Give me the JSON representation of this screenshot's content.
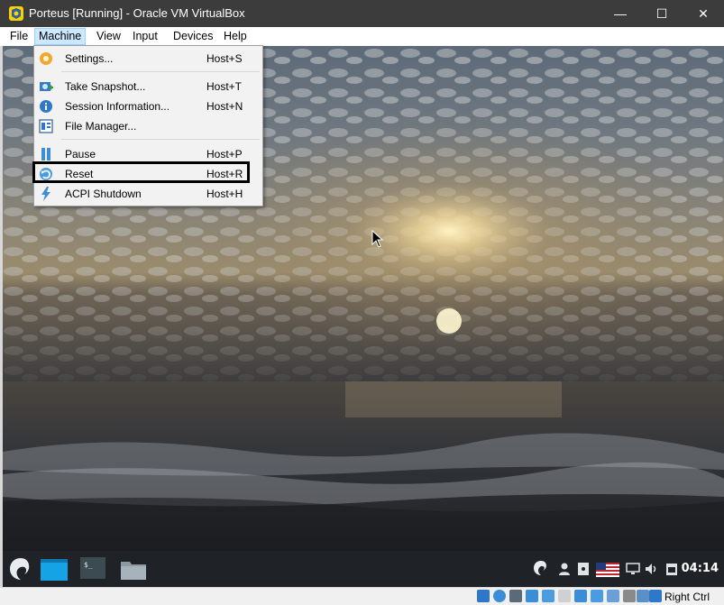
{
  "window": {
    "title": "Porteus [Running] - Oracle VM VirtualBox",
    "controls": {
      "minimize": "—",
      "maximize": "☐",
      "close": "✕"
    }
  },
  "menubar": {
    "items": [
      {
        "label": "File"
      },
      {
        "label": "Machine",
        "active": true
      },
      {
        "label": "View"
      },
      {
        "label": "Input"
      },
      {
        "label": "Devices"
      },
      {
        "label": "Help"
      }
    ]
  },
  "machine_menu": {
    "items": [
      {
        "label": "Settings...",
        "shortcut": "Host+S",
        "icon": "settings-icon"
      },
      {
        "label": "Take Snapshot...",
        "shortcut": "Host+T",
        "icon": "snapshot-icon"
      },
      {
        "label": "Session Information...",
        "shortcut": "Host+N",
        "icon": "info-icon"
      },
      {
        "label": "File Manager...",
        "shortcut": "",
        "icon": "file-manager-icon"
      },
      {
        "label": "Pause",
        "shortcut": "Host+P",
        "icon": "pause-icon"
      },
      {
        "label": "Reset",
        "shortcut": "Host+R",
        "icon": "reset-icon",
        "highlighted": true
      },
      {
        "label": "ACPI Shutdown",
        "shortcut": "Host+H",
        "icon": "acpi-shutdown-icon"
      }
    ]
  },
  "guest": {
    "wallpaper": "sunset-over-sea",
    "clock": "04:14"
  },
  "statusbar": {
    "host_key": "Right Ctrl"
  },
  "colors": {
    "titlebar": "#3c3c3c",
    "menu_active": "#cce8ff",
    "taskbar": "#1f2327"
  }
}
